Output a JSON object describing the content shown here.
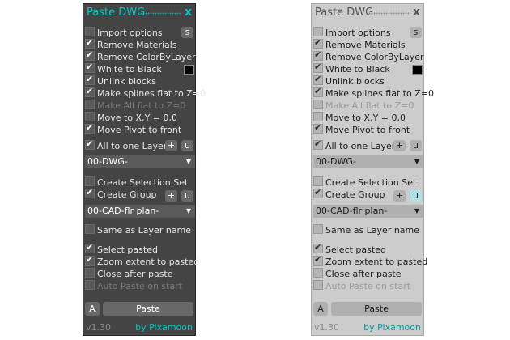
{
  "title": "Paste DWG",
  "close_label": "x",
  "options": {
    "import_options": "Import options",
    "remove_materials": "Remove Materials",
    "remove_colorbylayer": "Remove ColorByLayer",
    "white_to_black": "White to Black",
    "unlink_blocks": "Unlink blocks",
    "make_splines_flat": "Make splines flat to Z=0",
    "make_all_flat": "Make All flat to Z=0",
    "move_to_xyz": "Move to X,Y = 0,0",
    "move_pivot": "Move Pivot to front",
    "all_to_one_layer": "All to one Layer",
    "create_selection_set": "Create Selection Set",
    "create_group": "Create Group",
    "same_as_layer_name": "Same as Layer name",
    "select_pasted": "Select pasted",
    "zoom_extent": "Zoom extent to pasted",
    "close_after_paste": "Close after paste",
    "auto_paste": "Auto Paste on start"
  },
  "buttons": {
    "s": "s",
    "plus": "+",
    "u": "u",
    "a": "A",
    "paste": "Paste"
  },
  "dropdowns": {
    "layer": "00-DWG-",
    "group": "00-CAD-flr plan-"
  },
  "footer": {
    "version": "v1.30",
    "credit": "by Pixamoon"
  },
  "colors": {
    "dark_accent": "#00c8c8",
    "light_accent": "#009aa0",
    "dark_bg": "#444444",
    "light_bg": "#cccccc",
    "swatch": "#000000"
  },
  "icons": {
    "checkbox_mark": "check-icon",
    "dropdown_arrow": "chevron-down-icon",
    "close": "close-icon"
  }
}
